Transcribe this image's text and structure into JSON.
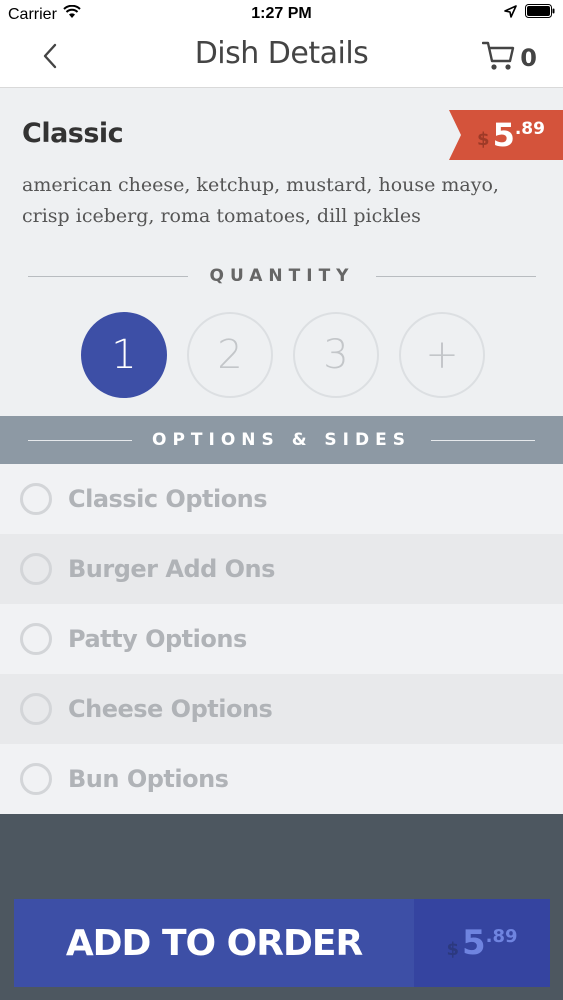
{
  "status_bar": {
    "carrier": "Carrier",
    "time": "1:27 PM"
  },
  "nav": {
    "title": "Dish Details",
    "cart_count": "0"
  },
  "dish": {
    "name": "Classic",
    "description": "american cheese, ketchup, mustard, house mayo, crisp iceberg, roma tomatoes, dill pickles",
    "price": {
      "currency": "$",
      "whole": "5",
      "fraction": ".89"
    }
  },
  "quantity": {
    "label": "QUANTITY",
    "options": [
      "1",
      "2",
      "3",
      "+"
    ],
    "selected": "1"
  },
  "options": {
    "header": "OPTIONS & SIDES",
    "items": [
      {
        "label": "Classic Options"
      },
      {
        "label": "Burger Add Ons"
      },
      {
        "label": "Patty Options"
      },
      {
        "label": "Cheese Options"
      },
      {
        "label": "Bun Options"
      }
    ]
  },
  "add_to_order": {
    "label": "ADD TO ORDER",
    "price": {
      "currency": "$",
      "whole": "5",
      "fraction": ".89"
    }
  },
  "colors": {
    "accent": "#3d4fa6",
    "price_tag": "#d4533b",
    "section_header": "#8d99a4",
    "footer": "#4d5760"
  }
}
